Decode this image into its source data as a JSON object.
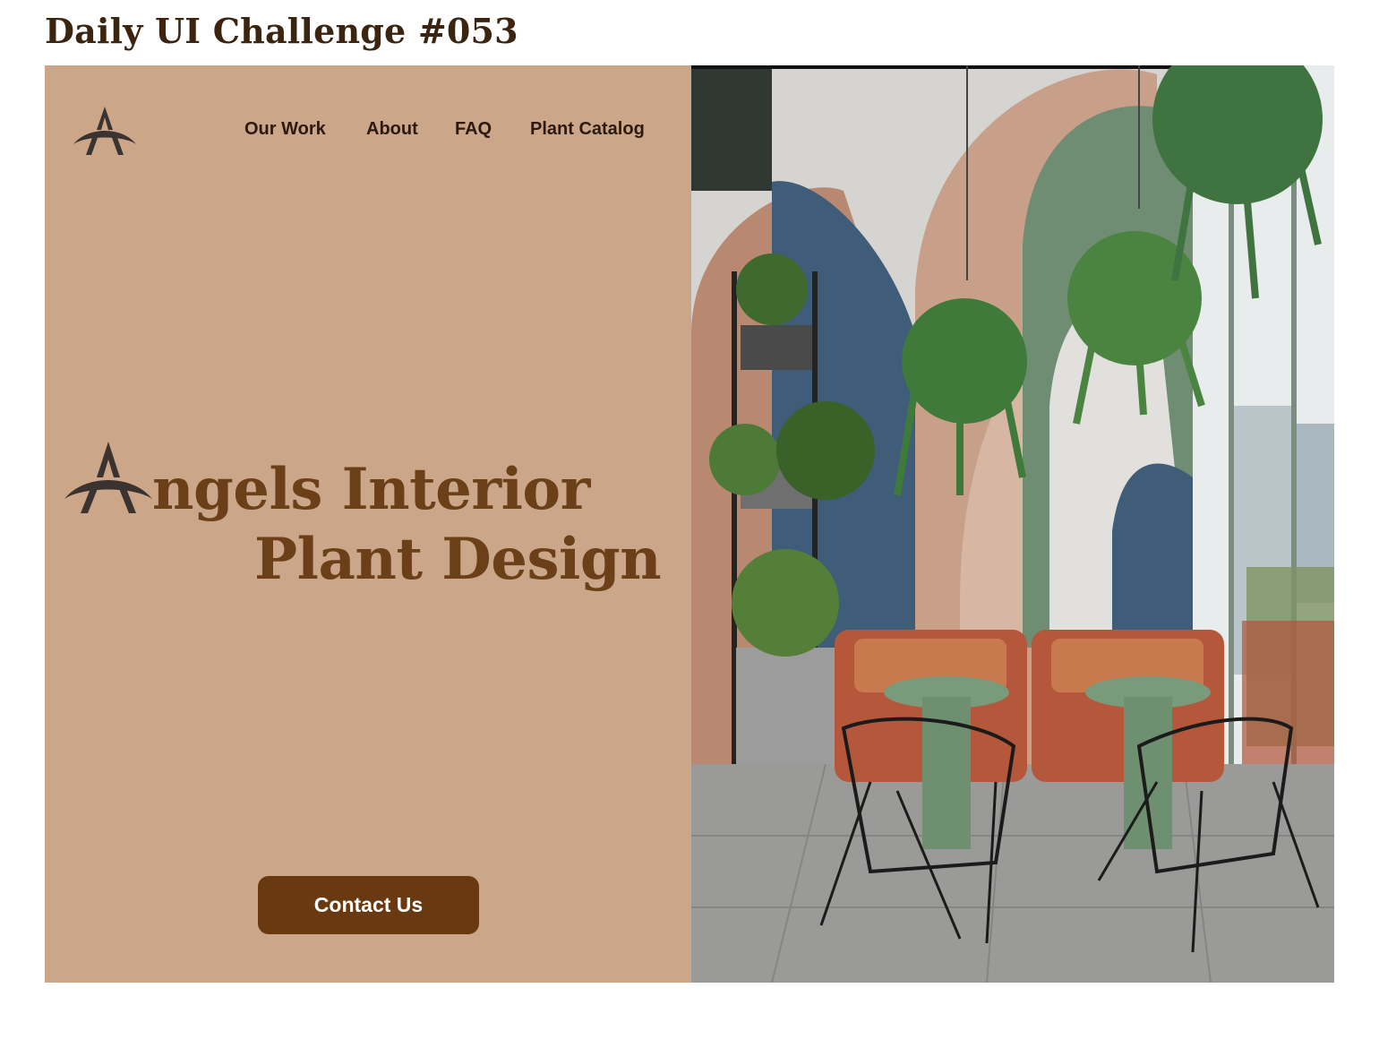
{
  "page": {
    "heading": "Daily UI Challenge #053"
  },
  "nav": {
    "items": [
      {
        "label": "Our Work"
      },
      {
        "label": "About"
      },
      {
        "label": "FAQ"
      },
      {
        "label": "Plant Catalog"
      }
    ]
  },
  "hero": {
    "line1": "ngels Interior",
    "line2": "Plant Design",
    "cta_label": "Contact Us"
  },
  "image": {
    "description_icon": "interior-photo"
  },
  "colors": {
    "panel": "#cca688",
    "title": "#6b4019",
    "button": "#693a12",
    "logo": "#3a3330",
    "nav_text": "#2c1a0e"
  }
}
